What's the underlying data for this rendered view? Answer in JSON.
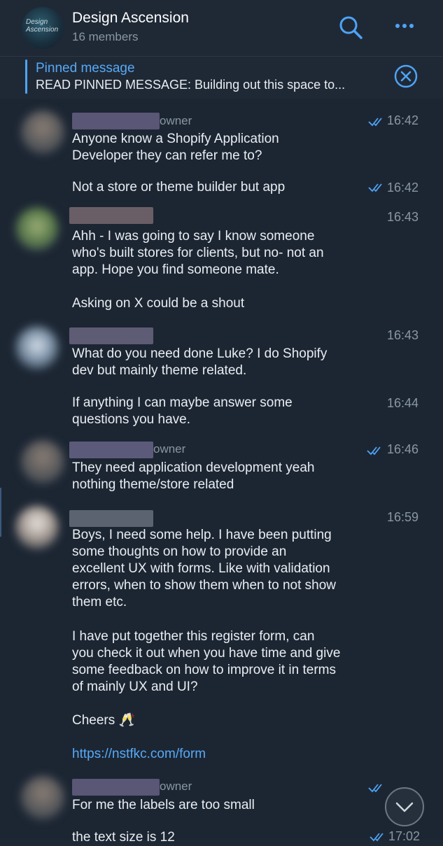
{
  "header": {
    "avatar_text": "Design Ascension",
    "title": "Design Ascension",
    "subtitle": "16 members",
    "search_icon": "search-icon",
    "more_icon": "more-dots-icon"
  },
  "pinned": {
    "title": "Pinned message",
    "text": "READ PINNED MESSAGE:  Building out this space to...",
    "close_icon": "close-circle-icon"
  },
  "messages": [
    {
      "role": "owner",
      "lines": "Anyone know a Shopify Application\nDeveloper they can refer me to?",
      "time": "16:42",
      "read": true
    },
    {
      "lines": "Not a store or theme builder but app",
      "time": "16:42",
      "read": true
    },
    {
      "lines": "Ahh - I was going to say I know someone\nwho's built stores for clients, but no- not an\napp. Hope you find someone mate.",
      "time": "16:43"
    },
    {
      "lines": "Asking on X could be a shout"
    },
    {
      "lines": "What do you need done Luke? I do Shopify\ndev but mainly theme related.",
      "time": "16:43"
    },
    {
      "lines": "If anything I can maybe answer some\nquestions you have.",
      "time": "16:44"
    },
    {
      "role": "owner",
      "lines": "They need application development yeah\nnothing theme/store related",
      "time": "16:46",
      "read": true
    },
    {
      "lines": "Boys, I need some help. I have been putting\nsome thoughts on how to provide an\nexcellent UX with forms. Like with validation\nerrors, when to show them when to not show\nthem etc.",
      "time": "16:59"
    },
    {
      "lines": "I have put together this register form, can\nyou check it out when you have time and give\nsome feedback on how to improve it in terms\nof mainly UX and UI?"
    },
    {
      "lines": "Cheers 🥂"
    },
    {
      "link": "https://nstfkc.com/form"
    },
    {
      "role": "owner",
      "lines": "For me the labels are too small",
      "read": true
    },
    {
      "lines": "the text size is 12",
      "time": "17:02",
      "read": true
    }
  ],
  "colors": {
    "accent": "#57a9f7",
    "background": "#1c2633",
    "header": "#1f2936"
  }
}
